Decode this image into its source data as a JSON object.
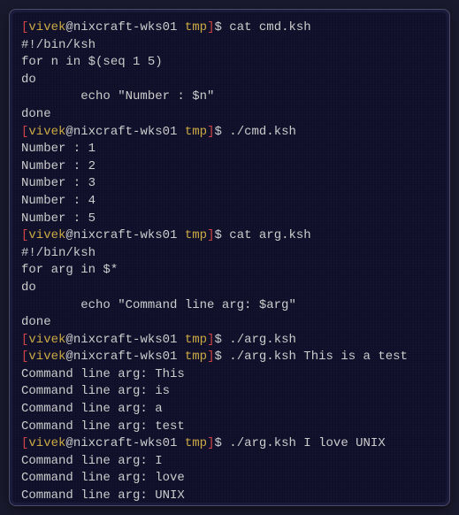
{
  "prompt": {
    "open_bracket": "[",
    "user": "vivek",
    "at": "@",
    "host": "nixcraft-wks01",
    "dir": "tmp",
    "close_bracket": "]",
    "dollar": "$"
  },
  "lines": [
    {
      "type": "prompt",
      "cmd": "cat cmd.ksh"
    },
    {
      "type": "output",
      "text": "#!/bin/ksh"
    },
    {
      "type": "output",
      "text": "for n in $(seq 1 5)"
    },
    {
      "type": "output",
      "text": "do"
    },
    {
      "type": "output",
      "text": "        echo \"Number : $n\""
    },
    {
      "type": "output",
      "text": "done"
    },
    {
      "type": "prompt",
      "cmd": "./cmd.ksh"
    },
    {
      "type": "output",
      "text": "Number : 1"
    },
    {
      "type": "output",
      "text": "Number : 2"
    },
    {
      "type": "output",
      "text": "Number : 3"
    },
    {
      "type": "output",
      "text": "Number : 4"
    },
    {
      "type": "output",
      "text": "Number : 5"
    },
    {
      "type": "prompt",
      "cmd": "cat arg.ksh"
    },
    {
      "type": "output",
      "text": "#!/bin/ksh"
    },
    {
      "type": "output",
      "text": "for arg in $*"
    },
    {
      "type": "output",
      "text": "do"
    },
    {
      "type": "output",
      "text": "        echo \"Command line arg: $arg\""
    },
    {
      "type": "output",
      "text": "done"
    },
    {
      "type": "prompt",
      "cmd": "./arg.ksh"
    },
    {
      "type": "prompt",
      "cmd": "./arg.ksh This is a test"
    },
    {
      "type": "output",
      "text": "Command line arg: This"
    },
    {
      "type": "output",
      "text": "Command line arg: is"
    },
    {
      "type": "output",
      "text": "Command line arg: a"
    },
    {
      "type": "output",
      "text": "Command line arg: test"
    },
    {
      "type": "prompt",
      "cmd": "./arg.ksh I love UNIX"
    },
    {
      "type": "output",
      "text": "Command line arg: I"
    },
    {
      "type": "output",
      "text": "Command line arg: love"
    },
    {
      "type": "output",
      "text": "Command line arg: UNIX"
    },
    {
      "type": "prompt_cursor",
      "cmd": ""
    }
  ]
}
